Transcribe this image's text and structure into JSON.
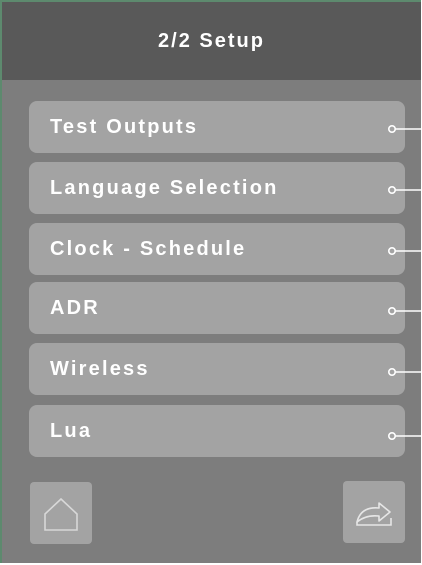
{
  "header": {
    "title": "2/2 Setup"
  },
  "menu": {
    "items": [
      {
        "label": "Test Outputs"
      },
      {
        "label": "Language Selection"
      },
      {
        "label": "Clock - Schedule"
      },
      {
        "label": "ADR"
      },
      {
        "label": "Wireless"
      },
      {
        "label": "Lua"
      }
    ]
  },
  "footer": {
    "home_icon": "home-icon",
    "return_icon": "return-arrow-icon"
  },
  "colors": {
    "background": "#7d7d7d",
    "header": "#595959",
    "button": "#a3a3a3",
    "text": "#ffffff",
    "frame_border": "#5d8a6e"
  }
}
